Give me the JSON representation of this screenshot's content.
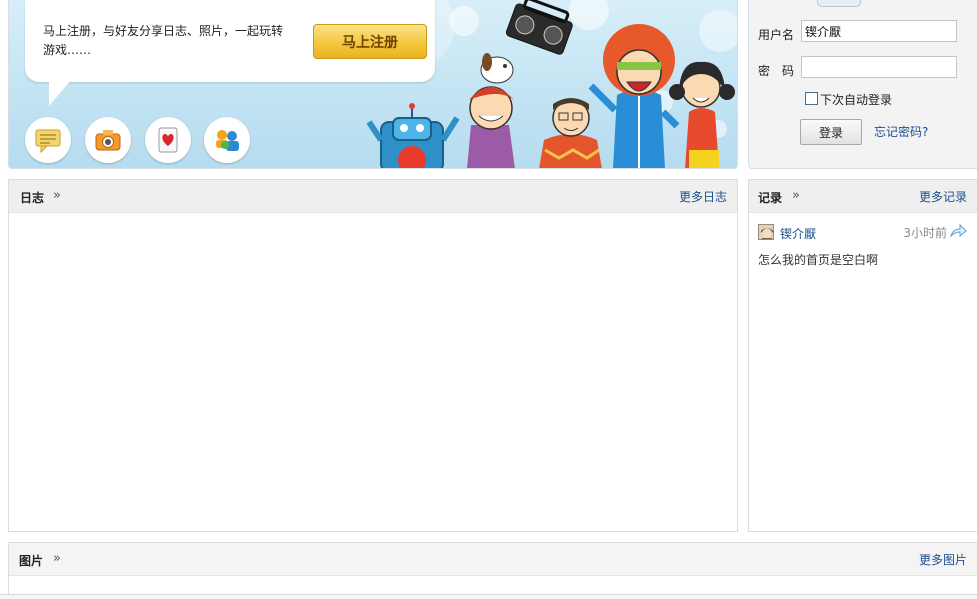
{
  "banner": {
    "promo_text": "马上注册，与好友分享日志、照片，一起玩转游戏……",
    "register_label": "马上注册",
    "feature_icons": [
      "message-icon",
      "camera-icon",
      "card-game-icon",
      "friends-icon"
    ]
  },
  "login": {
    "username_label": "用户名",
    "username_value": "锲介厭",
    "password_label": "密　码",
    "password_value": "",
    "remember_label": "下次自动登录",
    "remember_checked": false,
    "login_label": "登录",
    "forgot_label": "忘记密码?"
  },
  "blog": {
    "title": "日志",
    "more_label": "更多日志"
  },
  "records": {
    "title": "记录",
    "more_label": "更多记录",
    "items": [
      {
        "user": "锲介厭",
        "time": "3小时前",
        "content": "怎么我的首页是空白啊"
      }
    ]
  },
  "photos": {
    "title": "图片",
    "more_label": "更多图片"
  },
  "colors": {
    "link": "#1d4f8c",
    "banner_sky": "#c3e4f3",
    "register_gold": "#f4c63c",
    "panel_header": "#efefef"
  }
}
